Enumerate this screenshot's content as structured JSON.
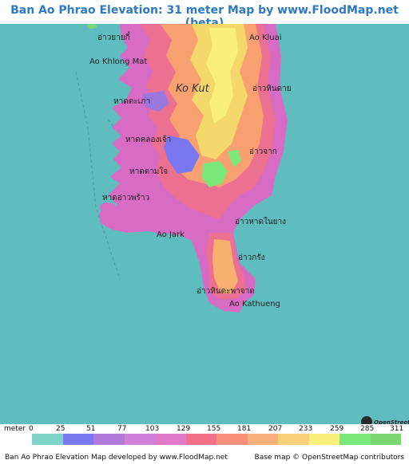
{
  "title": "Ban Ao Phrao Elevation: 31 meter Map by www.FloodMap.net (beta)",
  "colors": {
    "sea": "#5fbcbf",
    "title": "#2e78c4"
  },
  "places": [
    {
      "id": "ao-yai-thai",
      "text": "อ่าวยายกี๋"
    },
    {
      "id": "ao-khlong-mat",
      "text": "Ao Khlong Mat"
    },
    {
      "id": "ao-kluai",
      "text": "Ao Kluai"
    },
    {
      "id": "ko-kut",
      "text": "Ko Kut"
    },
    {
      "id": "ao-hin-sai",
      "text": "อ่าวหินดาย"
    },
    {
      "id": "hat-khlong-chao",
      "text": "หาดคลองเจ้า"
    },
    {
      "id": "ao-jak",
      "text": "อ่าวจาก"
    },
    {
      "id": "hat-khlong-ao",
      "text": "หาดตะเภา"
    },
    {
      "id": "hat-khlong-yai",
      "text": "หาดตามใจ"
    },
    {
      "id": "hat-ao-phrao",
      "text": "หาดอ่าวพร้าว"
    },
    {
      "id": "ao-hat-nai-yang",
      "text": "อ่าวหาดในยาง"
    },
    {
      "id": "ao-jark",
      "text": "Ao Jark"
    },
    {
      "id": "ao-krang",
      "text": "อ่าวกรัง"
    },
    {
      "id": "ao-hin-tabaed",
      "text": "อ่าวหินดะพาจาด"
    },
    {
      "id": "ao-kathueng",
      "text": "Ao Kathueng"
    }
  ],
  "legend": {
    "unit": "meter",
    "ticks": [
      "0",
      "25",
      "51",
      "77",
      "103",
      "129",
      "155",
      "181",
      "207",
      "233",
      "259",
      "285",
      "311"
    ],
    "colors": [
      "#7fd4c8",
      "#7a78f0",
      "#b07ad8",
      "#d080d8",
      "#e07ac8",
      "#f0708a",
      "#f8907a",
      "#f8b07a",
      "#f8d07a",
      "#f8f07a",
      "#7ae878",
      "#7ad870"
    ]
  },
  "osm_logo_text": "OpenStreetMap",
  "footer": {
    "left": "Ban Ao Phrao Elevation Map developed by www.FloodMap.net",
    "right": "Base map © OpenStreetMap contributors"
  }
}
